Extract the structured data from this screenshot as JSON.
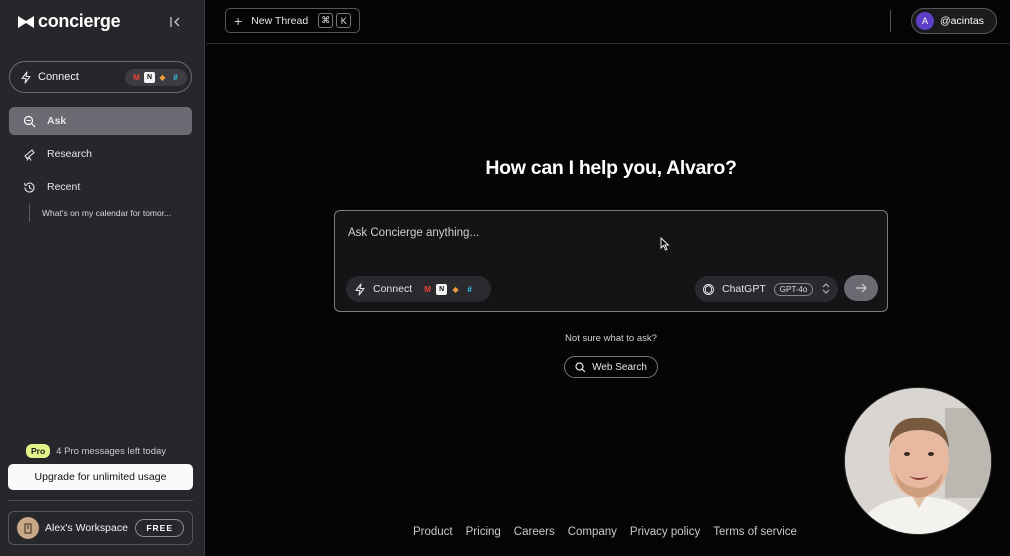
{
  "app": {
    "name": "concierge"
  },
  "sidebar": {
    "connect_label": "Connect",
    "connected_apps": [
      {
        "name": "gmail-icon",
        "glyph": "M",
        "color": "#ea4335"
      },
      {
        "name": "notion-icon",
        "glyph": "N",
        "color": "#f5f5f5"
      },
      {
        "name": "box-icon",
        "glyph": "◆",
        "color": "#f29d38"
      },
      {
        "name": "slack-icon",
        "glyph": "#",
        "color": "#36c5f0"
      }
    ],
    "nav": [
      {
        "label": "Ask",
        "icon": "ask-icon"
      },
      {
        "label": "Research",
        "icon": "telescope-icon"
      },
      {
        "label": "Recent",
        "icon": "history-icon"
      }
    ],
    "recent_items": [
      "What's on my calendar for tomor..."
    ],
    "pro_badge": "Pro",
    "pro_message": "4 Pro messages left today",
    "upgrade_label": "Upgrade for unlimited usage",
    "workspace_name": "Alex's Workspace",
    "plan_badge": "FREE"
  },
  "topbar": {
    "new_thread_label": "New Thread",
    "shortcut_keys": [
      "⌘",
      "K"
    ],
    "user_initial": "A",
    "user_handle": "@acintas"
  },
  "main": {
    "greeting": "How can I help you, Alvaro?",
    "input_placeholder": "Ask Concierge anything...",
    "connect_label": "Connect",
    "model_name": "ChatGPT",
    "model_version": "GPT-4o",
    "suggestion_prompt": "Not sure what to ask?",
    "web_search_label": "Web Search"
  },
  "footer": {
    "links": [
      "Product",
      "Pricing",
      "Careers",
      "Company",
      "Privacy policy",
      "Terms of service"
    ]
  },
  "colors": {
    "sidebar_bg": "#27272b",
    "main_bg": "#050505",
    "active_nav": "#6a6a72",
    "pro_badge": "#e4f28a",
    "user_avatar": "#5e3fc7"
  }
}
